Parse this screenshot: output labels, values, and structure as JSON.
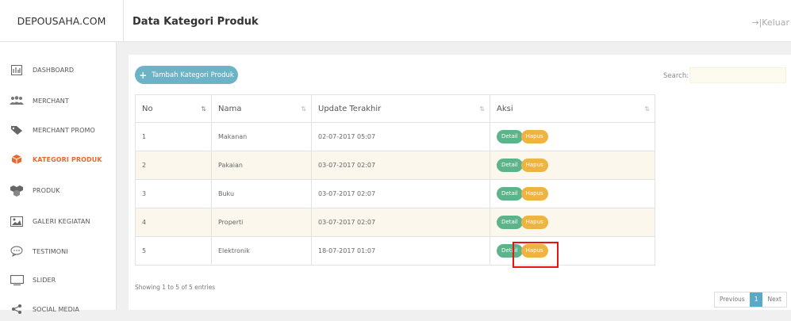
{
  "brand": "DEPOUSAHA.COM",
  "header": {
    "title": "Data Kategori Produk",
    "logout_label": "Keluar"
  },
  "sidebar": {
    "items": [
      {
        "label": "DASHBOARD",
        "icon": "chart-icon"
      },
      {
        "label": "MERCHANT",
        "icon": "users-icon"
      },
      {
        "label": "MERCHANT PROMO",
        "icon": "tags-icon"
      },
      {
        "label": "KATEGORI PRODUK",
        "icon": "box-icon",
        "active": true
      },
      {
        "label": "PRODUK",
        "icon": "cubes-icon"
      },
      {
        "label": "GALERI KEGIATAN",
        "icon": "image-icon"
      },
      {
        "label": "TESTIMONI",
        "icon": "comment-icon"
      },
      {
        "label": "SLIDER",
        "icon": "monitor-icon"
      },
      {
        "label": "SOCIAL MEDIA",
        "icon": "share-icon"
      }
    ]
  },
  "toolbar": {
    "add_label": "Tambah Kategori Produk",
    "search_label": "Search:",
    "search_value": ""
  },
  "table": {
    "headers": [
      "No",
      "Nama",
      "Update Terakhir",
      "Aksi"
    ],
    "rows": [
      {
        "no": "1",
        "nama": "Makanan",
        "updated": "02-07-2017 05:07"
      },
      {
        "no": "2",
        "nama": "Pakaian",
        "updated": "03-07-2017 02:07"
      },
      {
        "no": "3",
        "nama": "Buku",
        "updated": "03-07-2017 02:07"
      },
      {
        "no": "4",
        "nama": "Properti",
        "updated": "03-07-2017 02:07"
      },
      {
        "no": "5",
        "nama": "Elektronik",
        "updated": "18-07-2017 01:07"
      }
    ],
    "detail_label": "Detail",
    "hapus_label": "Hapus"
  },
  "footer": {
    "entries": "Showing 1 to 5 of 5 entries",
    "prev": "Previous",
    "page": "1",
    "next": "Next"
  },
  "colors": {
    "accent": "#6cb3c6",
    "active_nav": "#e8692e",
    "detail": "#5db38a",
    "hapus": "#eeb441",
    "highlight": "#e8140f"
  }
}
